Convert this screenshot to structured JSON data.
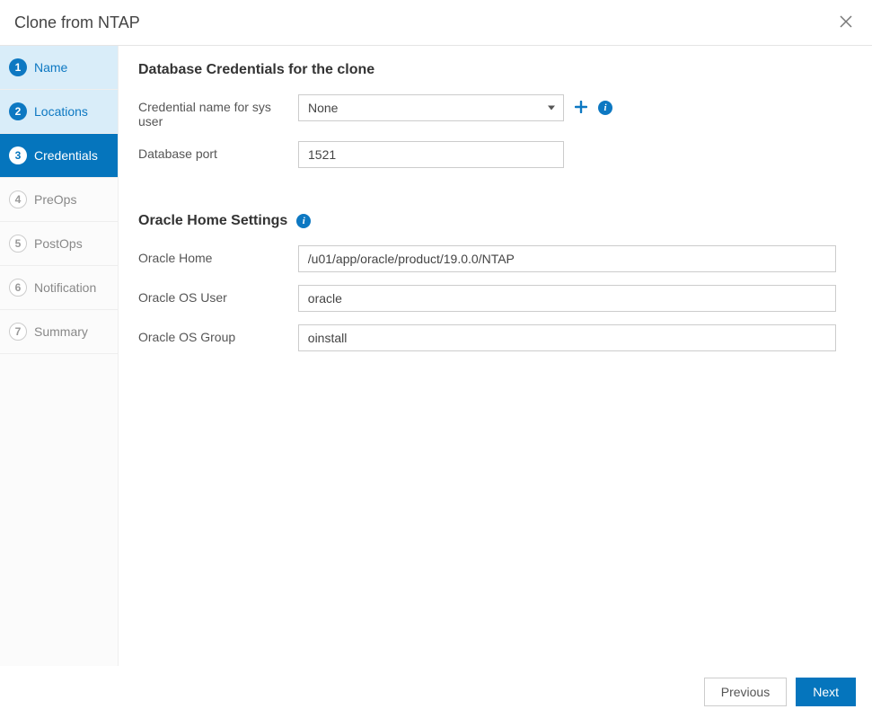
{
  "header": {
    "title": "Clone from NTAP"
  },
  "sidebar": {
    "steps": [
      {
        "num": "1",
        "label": "Name",
        "state": "completed"
      },
      {
        "num": "2",
        "label": "Locations",
        "state": "completed"
      },
      {
        "num": "3",
        "label": "Credentials",
        "state": "active"
      },
      {
        "num": "4",
        "label": "PreOps",
        "state": "pending"
      },
      {
        "num": "5",
        "label": "PostOps",
        "state": "pending"
      },
      {
        "num": "6",
        "label": "Notification",
        "state": "pending"
      },
      {
        "num": "7",
        "label": "Summary",
        "state": "pending"
      }
    ]
  },
  "main": {
    "section1_title": "Database Credentials for the clone",
    "cred_label": "Credential name for sys user",
    "cred_value": "None",
    "port_label": "Database port",
    "port_value": "1521",
    "section2_title": "Oracle Home Settings",
    "oracle_home_label": "Oracle Home",
    "oracle_home_value": "/u01/app/oracle/product/19.0.0/NTAP",
    "oracle_os_user_label": "Oracle OS User",
    "oracle_os_user_value": "oracle",
    "oracle_os_group_label": "Oracle OS Group",
    "oracle_os_group_value": "oinstall"
  },
  "footer": {
    "previous": "Previous",
    "next": "Next"
  }
}
